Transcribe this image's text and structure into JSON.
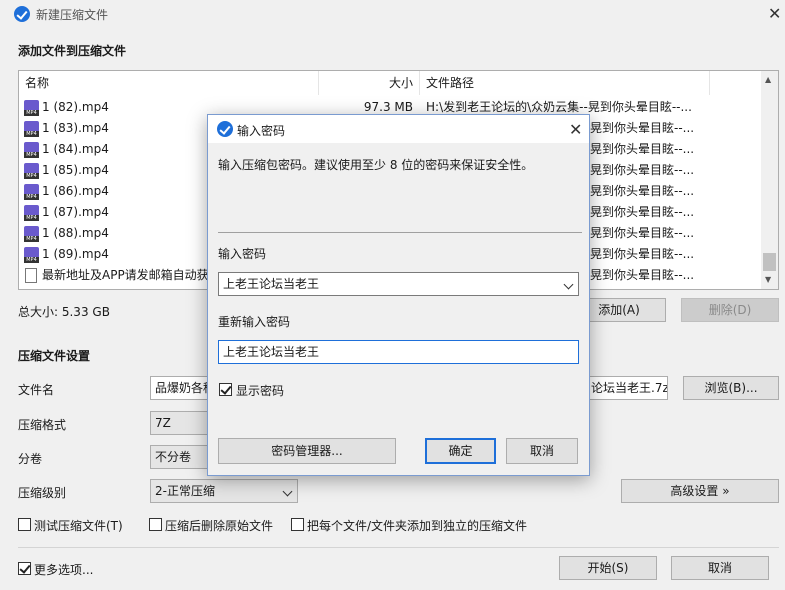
{
  "window": {
    "title": "新建压缩文件"
  },
  "section_add": "添加文件到压缩文件",
  "list": {
    "col_name": "名称",
    "col_size": "大小",
    "col_path": "文件路径",
    "rows": [
      {
        "name": "1 (82).mp4",
        "size": "97.3 MB",
        "path": "H:\\发到老王论坛的\\众奶云集--晃到你头晕目眩--..."
      },
      {
        "name": "1 (83).mp4",
        "size": "",
        "path": "晃到你头晕目眩--..."
      },
      {
        "name": "1 (84).mp4",
        "size": "",
        "path": "晃到你头晕目眩--..."
      },
      {
        "name": "1 (85).mp4",
        "size": "",
        "path": "晃到你头晕目眩--..."
      },
      {
        "name": "1 (86).mp4",
        "size": "",
        "path": "晃到你头晕目眩--..."
      },
      {
        "name": "1 (87).mp4",
        "size": "",
        "path": "晃到你头晕目眩--..."
      },
      {
        "name": "1 (88).mp4",
        "size": "",
        "path": "晃到你头晕目眩--..."
      },
      {
        "name": "1 (89).mp4",
        "size": "",
        "path": "晃到你头晕目眩--..."
      },
      {
        "name": "最新地址及APP请发邮箱自动获",
        "size": "",
        "path": "晃到你头晕目眩--..."
      }
    ]
  },
  "total_size": "总大小: 5.33 GB",
  "add_button": "添加(A)",
  "delete_button": "删除(D)",
  "section_settings": "压缩文件设置",
  "filename_label": "文件名",
  "filename_value": "品爆奶各种",
  "filename_value_tail": "论坛当老王.7z",
  "browse_button": "浏览(B)...",
  "format_label": "压缩格式",
  "format_value": "7Z",
  "split_label": "分卷",
  "split_value": "不分卷",
  "level_label": "压缩级别",
  "level_value": "2-正常压缩",
  "advanced_button": "高级设置 »",
  "opt_test": "测试压缩文件(T)",
  "opt_delete": "压缩后删除原始文件",
  "opt_separate": "把每个文件/文件夹添加到独立的压缩文件",
  "more_options": "更多选项...",
  "start_button": "开始(S)",
  "cancel_button": "取消",
  "dialog": {
    "title": "输入密码",
    "hint": "输入压缩包密码。建议使用至少 8 位的密码来保证安全性。",
    "enter_label": "输入密码",
    "password": "上老王论坛当老王",
    "reenter_label": "重新输入密码",
    "password_confirm": "上老王论坛当老王",
    "show_password": "显示密码",
    "manager_button": "密码管理器...",
    "ok_button": "确定",
    "cancel_button": "取消"
  }
}
